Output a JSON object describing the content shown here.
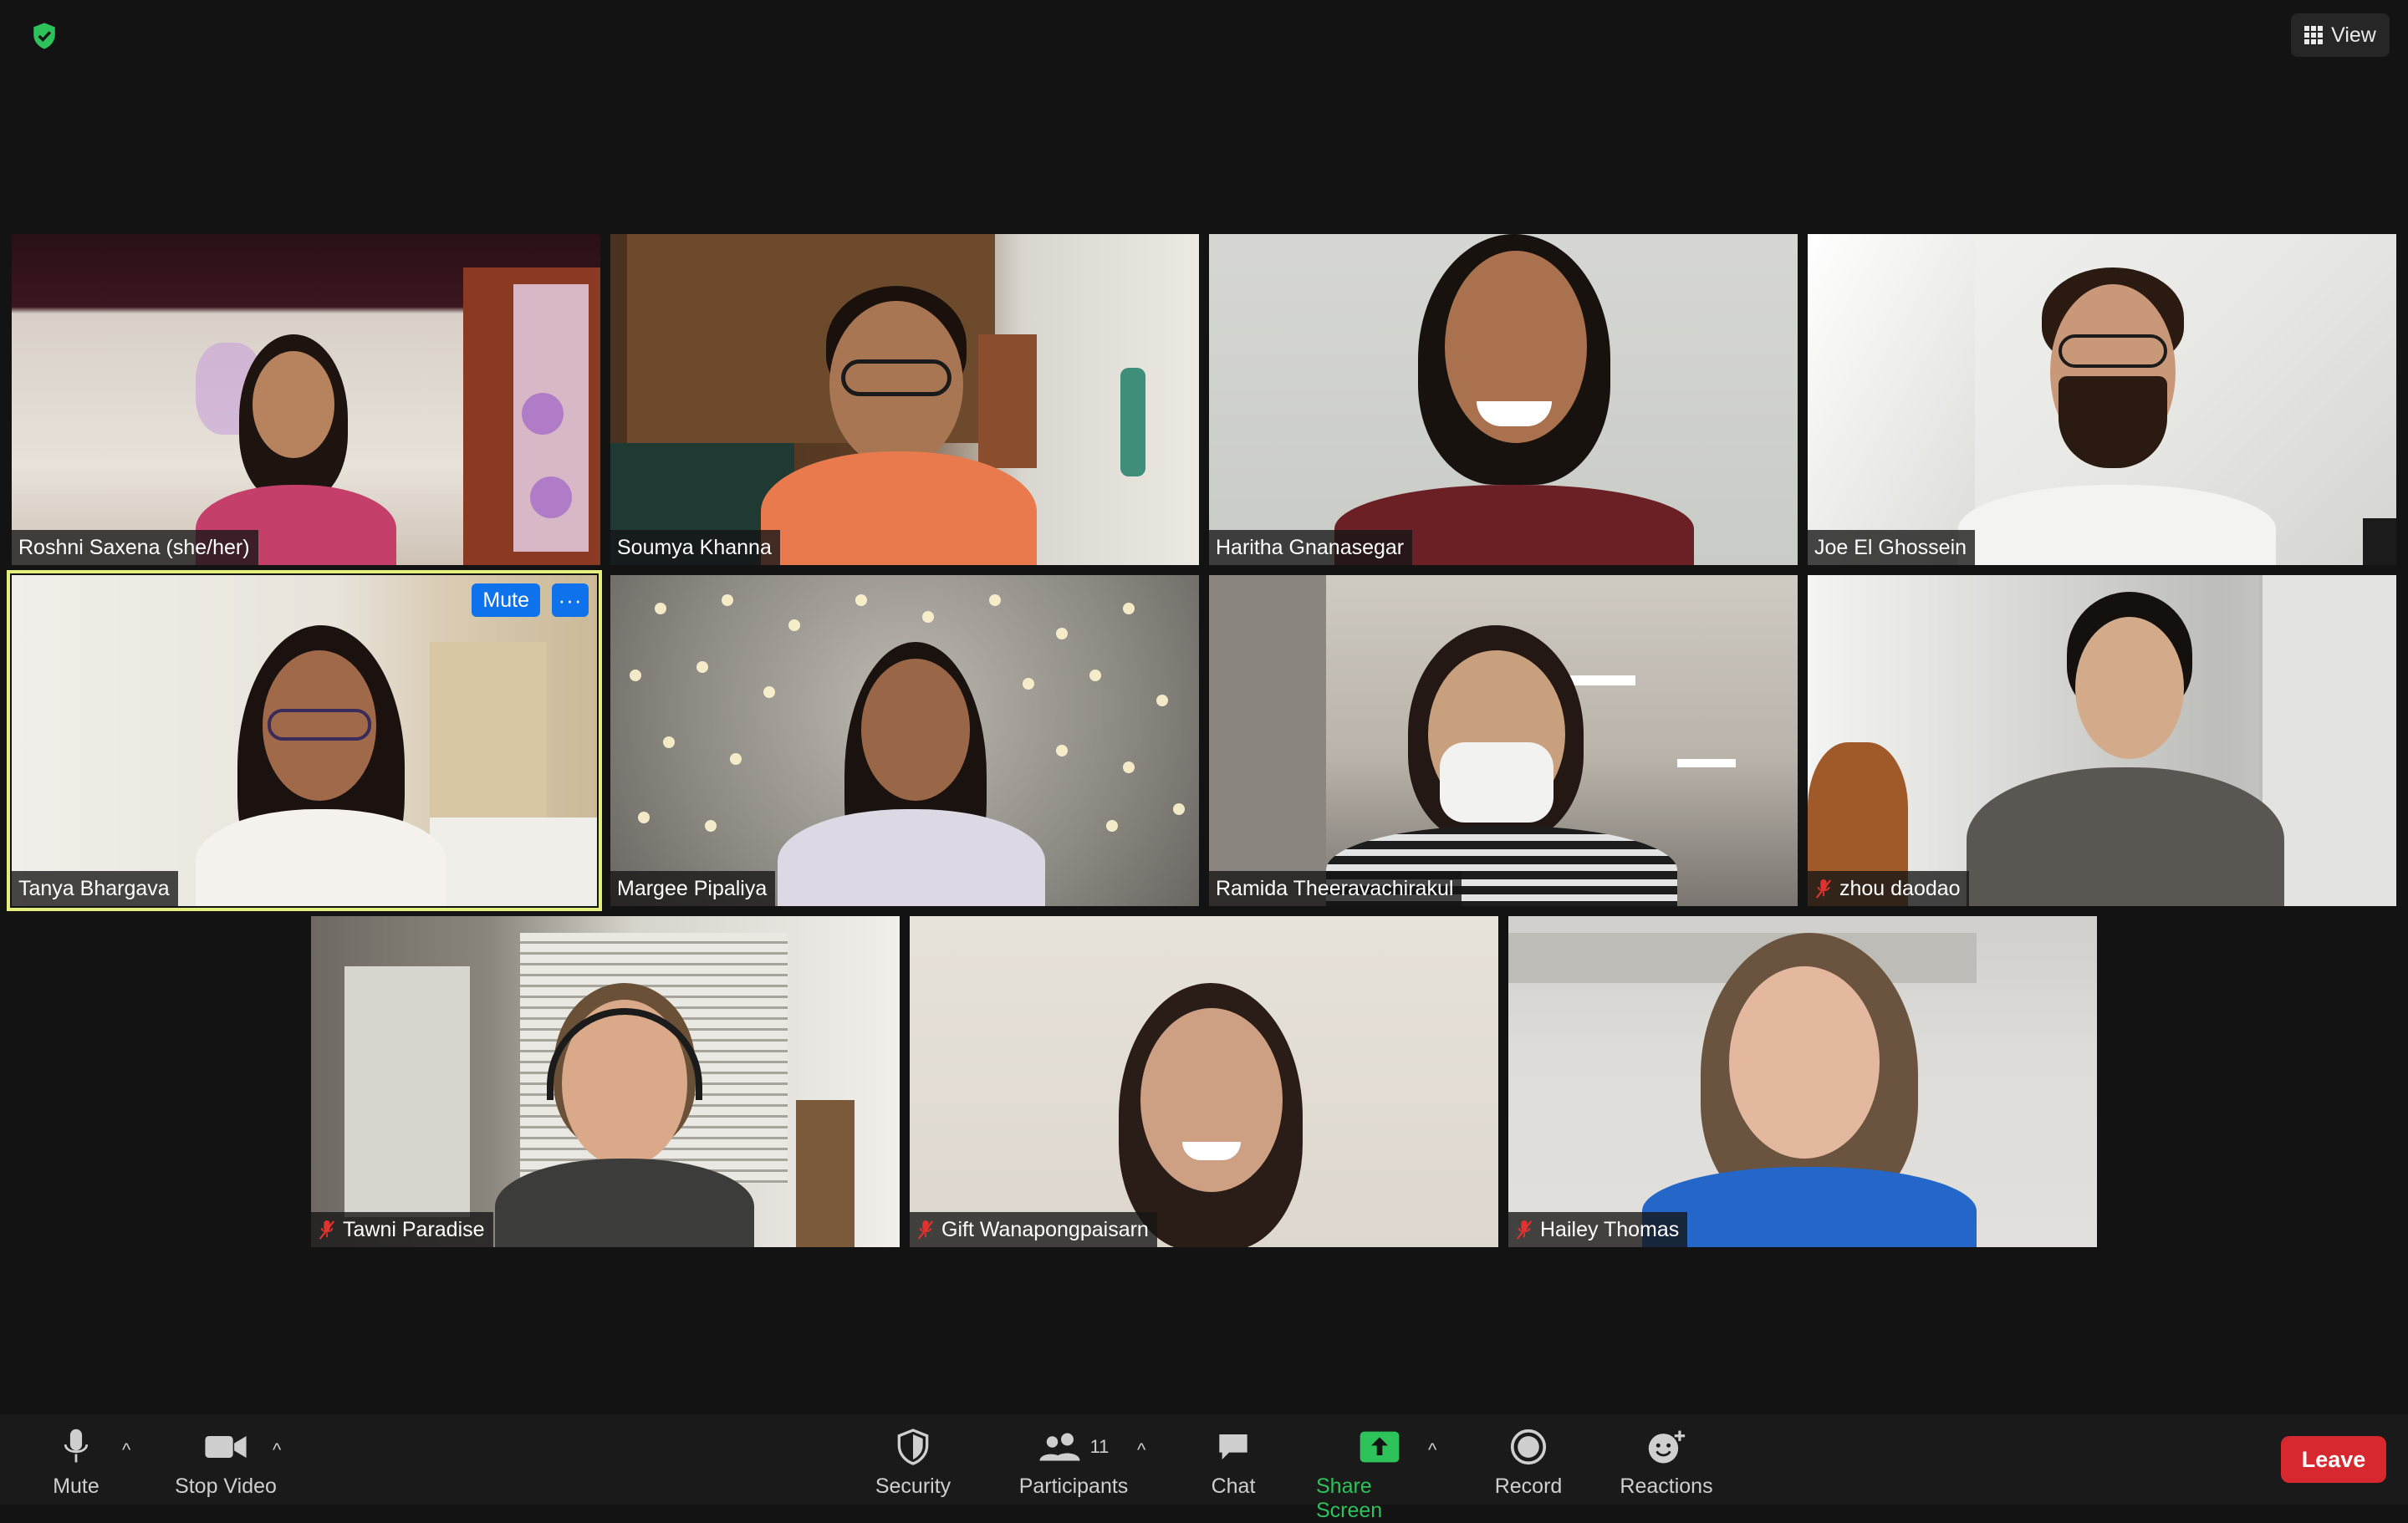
{
  "topbar": {
    "view_label": "View"
  },
  "participants": [
    {
      "name": "Roshni Saxena (she/her)",
      "muted": false
    },
    {
      "name": "Soumya Khanna",
      "muted": false
    },
    {
      "name": "Haritha Gnanasegar",
      "muted": false
    },
    {
      "name": "Joe El Ghossein",
      "muted": false
    },
    {
      "name": "Tanya Bhargava",
      "muted": false,
      "active": true,
      "mute_label": "Mute",
      "more_label": "···"
    },
    {
      "name": "Margee Pipaliya",
      "muted": false
    },
    {
      "name": "Ramida Theeravachirakul",
      "muted": false
    },
    {
      "name": "zhou daodao",
      "muted": true
    },
    {
      "name": "Tawni Paradise",
      "muted": true
    },
    {
      "name": "Gift Wanapongpaisarn",
      "muted": true
    },
    {
      "name": "Hailey Thomas",
      "muted": true
    }
  ],
  "toolbar": {
    "mute_label": "Mute",
    "video_label": "Stop Video",
    "security_label": "Security",
    "participants_label": "Participants",
    "participants_count": "11",
    "chat_label": "Chat",
    "share_label": "Share Screen",
    "record_label": "Record",
    "reactions_label": "Reactions",
    "leave_label": "Leave",
    "caret": "^"
  },
  "colors": {
    "active_speaker": "#e3ee7c",
    "blue_button": "#0e72ed",
    "share_green": "#2ec25a",
    "leave_red": "#d7282f",
    "muted_red": "#e0322f"
  }
}
